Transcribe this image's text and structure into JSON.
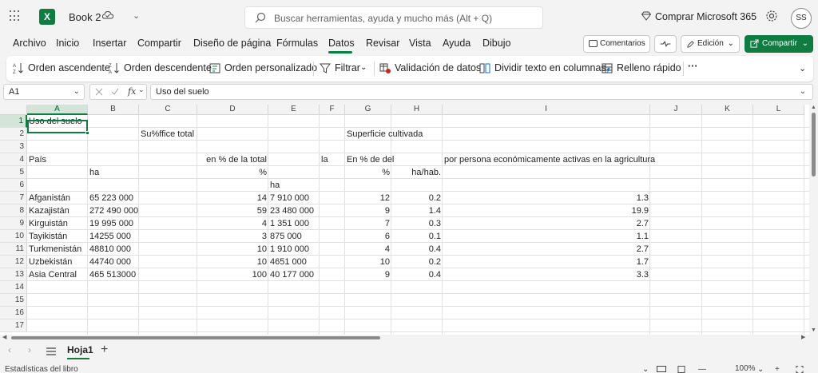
{
  "app": {
    "title": "Book 2",
    "search_placeholder": "Buscar herramientas, ayuda y mucho más (Alt + Q)",
    "buy_label": "Comprar Microsoft 365",
    "avatar_initials": "SS",
    "logo_letter": "X",
    "accent_color": "#107c41"
  },
  "menu": {
    "tabs": [
      "Archivo",
      "Inicio",
      "Insertar",
      "Compartir",
      "Diseño de página",
      "Fórmulas",
      "Datos",
      "Revisar",
      "Vista",
      "Ayuda",
      "Dibujo"
    ],
    "active_tab": "Datos",
    "comments_label": "Comentarios",
    "edit_label": "Edición",
    "share_label": "Compartir"
  },
  "ribbon": {
    "sort_asc": "Orden ascendente",
    "sort_desc": "Orden descendente",
    "sort_custom": "Orden personalizado",
    "filter": "Filtrar",
    "validation": "Validación de datos",
    "split_text": "Dividir texto en columnas",
    "flash_fill": "Relleno rápido",
    "more": "···"
  },
  "formula_bar": {
    "cell_ref": "A1",
    "fx": "fx",
    "content": "Uso del suelo"
  },
  "grid": {
    "columns": [
      "A",
      "B",
      "C",
      "D",
      "E",
      "F",
      "G",
      "H",
      "I",
      "J",
      "K",
      "L"
    ],
    "rows": [
      "1",
      "2",
      "3",
      "4",
      "5",
      "6",
      "7",
      "8",
      "9",
      "10",
      "11",
      "12",
      "13",
      "14",
      "15",
      "16",
      "17"
    ],
    "cells": {
      "A1": "Uso del suelo",
      "C2": "Su%ffice total",
      "G2": "Superficie cultivada",
      "A4": "País",
      "D4": "en % de la total",
      "F4": "la",
      "G4": "En % de del",
      "I4": "por persona económicamente activas en la agricultura",
      "B5": "ha",
      "D5": "%",
      "G5": "%",
      "H5": "ha/hab.",
      "E6": "ha",
      "A7": "Afganistán",
      "B7": "65 223 000",
      "D7": "14",
      "E7": "7 910 000",
      "G7": "12",
      "H7": "0.2",
      "I7": "1.3",
      "A8": "Kazajistán",
      "B8": "272 490 000",
      "D8": "59",
      "E8": "23 480 000",
      "G8": "9",
      "H8": "1.4",
      "I8": "19.9",
      "A9": "Kirguistán",
      "B9": "19 995 000",
      "D9": "4",
      "E9": "1 351 000",
      "G9": "7",
      "H9": "0.3",
      "I9": "2.7",
      "A10": "Tayikistán",
      "B10": "14255 000",
      "D10": "3",
      "E10": "875 000",
      "G10": "6",
      "H10": "0.1",
      "I10": "1.1",
      "A11": "Turkmenistán",
      "B11": "48810 000",
      "D11": "10",
      "E11": "1 910 000",
      "G11": "4",
      "H11": "0.4",
      "I11": "2.7",
      "A12": "Uzbekistán",
      "B12": "44740 000",
      "D12": "10",
      "E12": "4651 000",
      "G12": "10",
      "H12": "0.2",
      "I12": "1.7",
      "A13": "Asia Central",
      "B13": "465 513000",
      "D13": "100",
      "E13": "40 177 000",
      "G13": "9",
      "H13": "0.4",
      "I13": "3.3"
    },
    "active_cell": "A1"
  },
  "sheets": {
    "tabs": [
      "Hoja1"
    ],
    "add_label": "+"
  },
  "status": {
    "text": "Estadísticas del libro",
    "zoom": "100%"
  }
}
